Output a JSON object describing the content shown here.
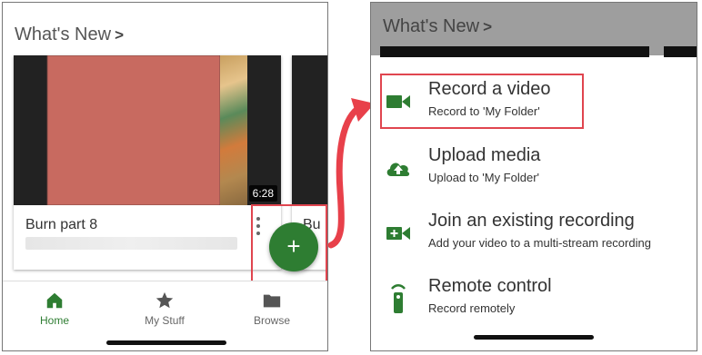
{
  "left_screen": {
    "section_title": "What's New",
    "section_chevron": ">",
    "card": {
      "title": "Burn part  8",
      "duration": "6:28"
    },
    "card2": {
      "title_partial": "Bu"
    },
    "fab_label": "+",
    "nav": [
      {
        "label": "Home",
        "icon": "home-icon",
        "active": true
      },
      {
        "label": "My Stuff",
        "icon": "star-icon",
        "active": false
      },
      {
        "label": "Browse",
        "icon": "folder-icon",
        "active": false
      }
    ]
  },
  "right_screen": {
    "section_title": "What's New",
    "section_chevron": ">",
    "menu": [
      {
        "label": "Record a video",
        "sub": "Record to 'My Folder'",
        "icon": "video-camera-icon"
      },
      {
        "label": "Upload media",
        "sub": "Upload to 'My Folder'",
        "icon": "cloud-upload-icon"
      },
      {
        "label": "Join an existing recording",
        "sub": "Add your video to a multi-stream recording",
        "icon": "video-add-icon"
      },
      {
        "label": "Remote control",
        "sub": "Record remotely",
        "icon": "remote-control-icon"
      }
    ]
  },
  "colors": {
    "accent_green": "#2e7d32",
    "highlight_red": "#e0454f",
    "arrow_red": "#e8404a"
  }
}
